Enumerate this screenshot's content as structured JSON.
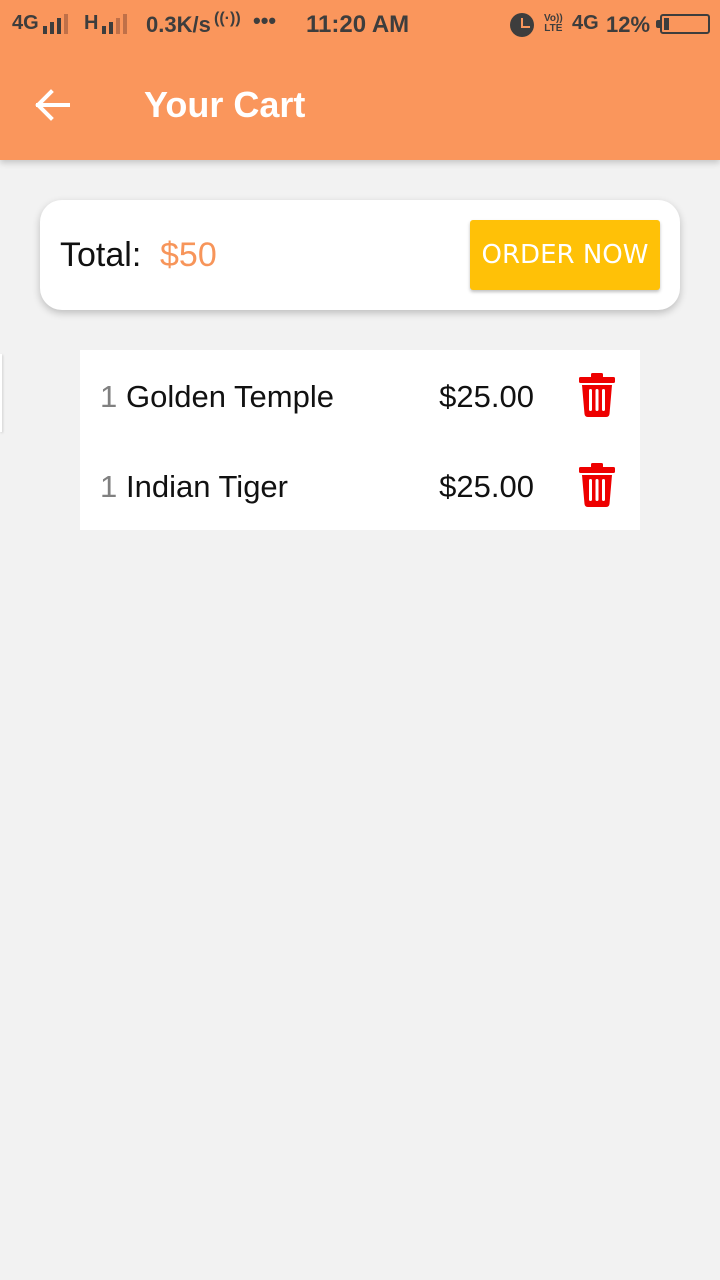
{
  "status_bar": {
    "network_1": "4G",
    "network_2": "H",
    "speed": "0.3K/s",
    "more": "•••",
    "time": "11:20 AM",
    "volte_top": "Vo))",
    "volte_bottom": "LTE",
    "network_3": "4G",
    "battery_percent": "12%",
    "battery_level": 0.12
  },
  "app_bar": {
    "title": "Your Cart",
    "back_icon": "arrow-left-icon"
  },
  "summary": {
    "total_label": "Total:",
    "total_value": "$50",
    "order_button": "ORDER NOW"
  },
  "cart": {
    "items": [
      {
        "qty": "1",
        "name": "Golden Temple",
        "price": "$25.00",
        "delete_icon": "trash-icon"
      },
      {
        "qty": "1",
        "name": "Indian Tiger",
        "price": "$25.00",
        "delete_icon": "trash-icon"
      }
    ]
  },
  "colors": {
    "header": "#fa965c",
    "accent_total": "#f7955a",
    "order_button": "#ffc107",
    "delete_icon": "#ee0000",
    "background": "#f2f2f2"
  }
}
